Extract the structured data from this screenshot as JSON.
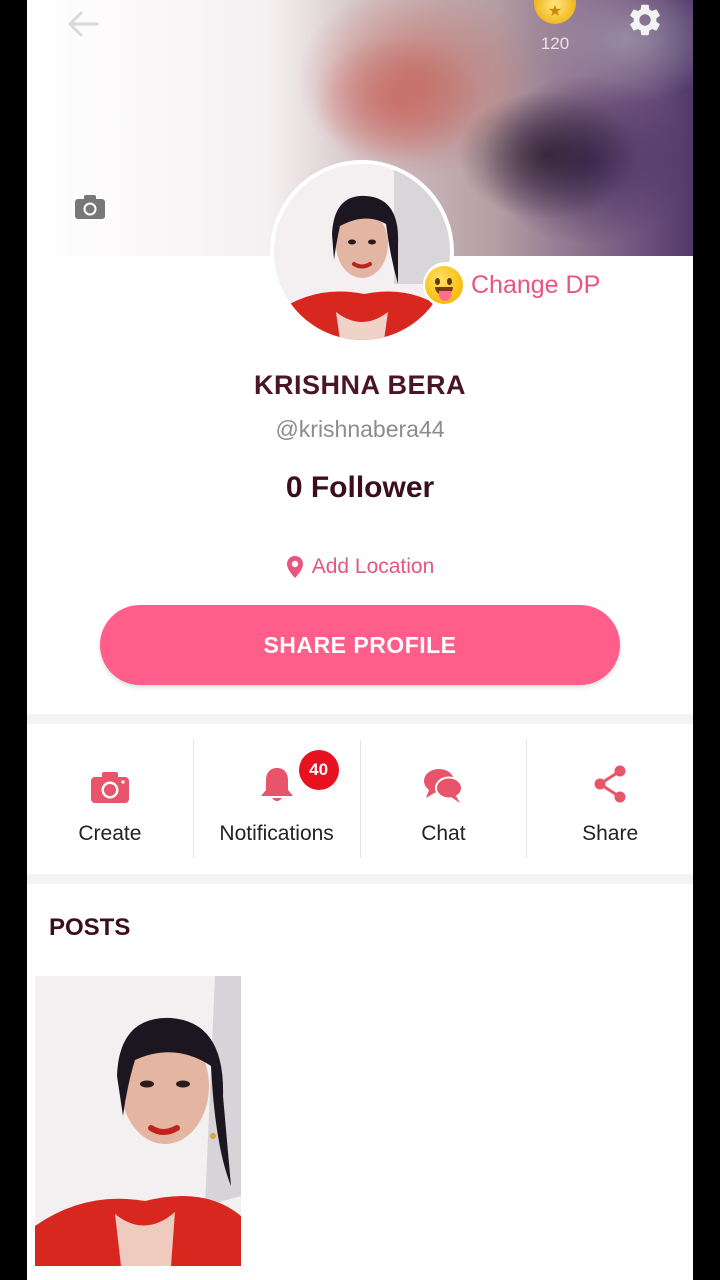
{
  "header": {
    "coin_count": "120"
  },
  "profile": {
    "change_dp_label": "Change DP",
    "name": "KRISHNA BERA",
    "handle": "@krishnabera44",
    "followers": "0 Follower",
    "location_label": "Add Location",
    "share_profile_label": "SHARE PROFILE"
  },
  "actions": [
    {
      "label": "Create",
      "icon": "camera-icon"
    },
    {
      "label": "Notifications",
      "icon": "bell-icon",
      "badge": "40"
    },
    {
      "label": "Chat",
      "icon": "chat-bubbles-icon"
    },
    {
      "label": "Share",
      "icon": "share-icon"
    }
  ],
  "posts": {
    "title": "POSTS"
  },
  "colors": {
    "accent": "#ff5e8a",
    "accent_text": "#e8557f",
    "badge": "#e8111f",
    "name_text": "#4a1625"
  }
}
